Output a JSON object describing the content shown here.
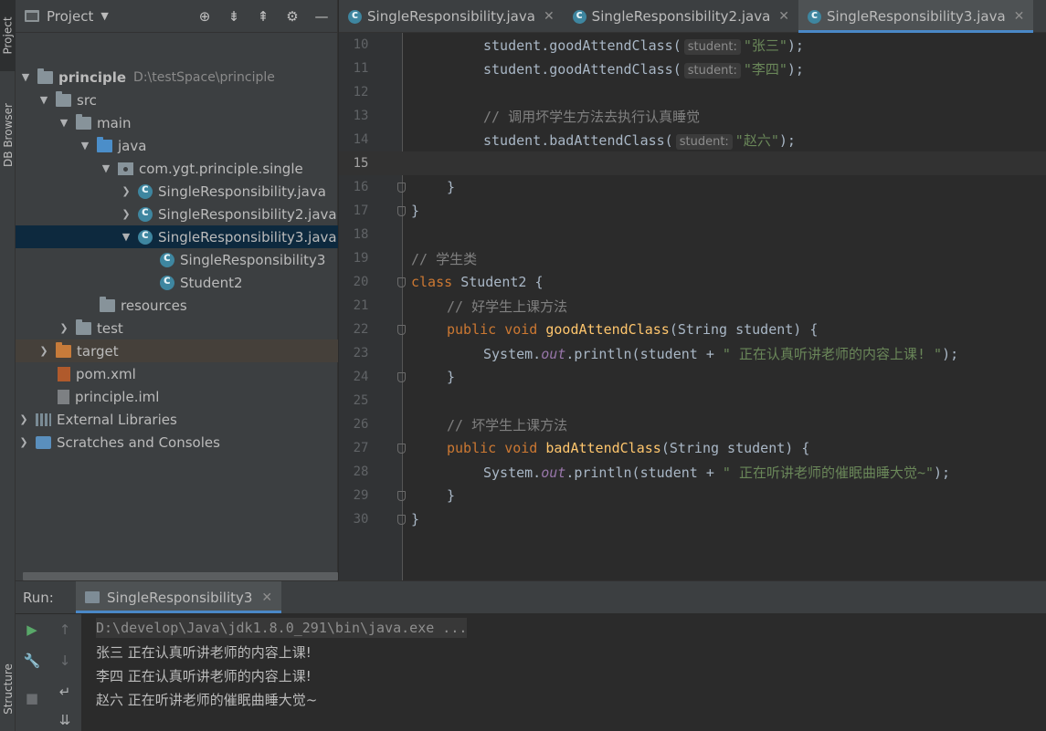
{
  "left_strip": {
    "project_tab": "Project",
    "db_tab": "DB Browser",
    "structure_tab": "Structure"
  },
  "project_panel": {
    "title": "Project",
    "tree": [
      {
        "label": "principle",
        "extra": "D:\\testSpace\\principle",
        "icon": "module-folder-icon"
      },
      {
        "label": "src",
        "icon": "folder-icon"
      },
      {
        "label": "main",
        "icon": "folder-icon"
      },
      {
        "label": "java",
        "icon": "source-folder-icon"
      },
      {
        "label": "com.ygt.principle.single",
        "icon": "package-icon"
      },
      {
        "label": "SingleResponsibility.java",
        "icon": "class-file-icon"
      },
      {
        "label": "SingleResponsibility2.java",
        "icon": "class-file-icon"
      },
      {
        "label": "SingleResponsibility3.java",
        "icon": "class-file-icon"
      },
      {
        "label": "SingleResponsibility3",
        "icon": "class-icon"
      },
      {
        "label": "Student2",
        "icon": "class-icon"
      },
      {
        "label": "resources",
        "icon": "resources-folder-icon"
      },
      {
        "label": "test",
        "icon": "folder-icon"
      },
      {
        "label": "target",
        "icon": "excluded-folder-icon"
      },
      {
        "label": "pom.xml",
        "icon": "maven-file-icon"
      },
      {
        "label": "principle.iml",
        "icon": "iml-file-icon"
      },
      {
        "label": "External Libraries",
        "icon": "libraries-icon"
      },
      {
        "label": "Scratches and Consoles",
        "icon": "scratches-icon"
      }
    ]
  },
  "editor": {
    "tabs": [
      {
        "label": "SingleResponsibility.java"
      },
      {
        "label": "SingleResponsibility2.java"
      },
      {
        "label": "SingleResponsibility3.java"
      }
    ],
    "active_tab": "SingleResponsibility3.java",
    "current_line": "15",
    "lines": [
      {
        "n": "10",
        "a": "student.goodAttendClass(",
        "hint": "student:",
        "s": "\"张三\"",
        "b": ");"
      },
      {
        "n": "11",
        "a": "student.goodAttendClass(",
        "hint": "student:",
        "s": "\"李四\"",
        "b": ");"
      },
      {
        "n": "12"
      },
      {
        "n": "13",
        "c": "// 调用坏学生方法去执行认真睡觉"
      },
      {
        "n": "14",
        "a": "student.badAttendClass(",
        "hint": "student:",
        "s": "\"赵六\"",
        "b": ");"
      },
      {
        "n": "15"
      },
      {
        "n": "16",
        "p": "}"
      },
      {
        "n": "17",
        "p": "}"
      },
      {
        "n": "18"
      },
      {
        "n": "19",
        "c": "// 学生类"
      },
      {
        "n": "20",
        "kw": "class",
        "name": "Student2",
        "p": "{"
      },
      {
        "n": "21",
        "c": "// 好学生上课方法"
      },
      {
        "n": "22",
        "kw": "public void",
        "fn": "goodAttendClass",
        "params": "(String student) {"
      },
      {
        "n": "23",
        "sys": "System.",
        "out": "out",
        "rest": ".println(student + ",
        "s": "\" 正在认真听讲老师的内容上课! \"",
        "b": ");"
      },
      {
        "n": "24",
        "p": "}"
      },
      {
        "n": "25"
      },
      {
        "n": "26",
        "c": "// 坏学生上课方法"
      },
      {
        "n": "27",
        "kw": "public void",
        "fn": "badAttendClass",
        "params": "(String student) {"
      },
      {
        "n": "28",
        "sys": "System.",
        "out": "out",
        "rest": ".println(student + ",
        "s": "\" 正在听讲老师的催眠曲睡大觉~\"",
        "b": ");"
      },
      {
        "n": "29",
        "p": "}"
      },
      {
        "n": "30",
        "p": "}"
      }
    ]
  },
  "run_panel": {
    "label": "Run:",
    "tab": "SingleResponsibility3",
    "command": "D:\\develop\\Java\\jdk1.8.0_291\\bin\\java.exe ...",
    "output": [
      "张三 正在认真听讲老师的内容上课!",
      "李四 正在认真听讲老师的内容上课!",
      "赵六 正在听讲老师的催眠曲睡大觉~"
    ]
  },
  "colors": {
    "keyword": "#cc7832",
    "string": "#6a8759",
    "comment": "#808080",
    "method": "#ffc66d",
    "accent": "#4a88c7",
    "selection": "#0d293e"
  }
}
